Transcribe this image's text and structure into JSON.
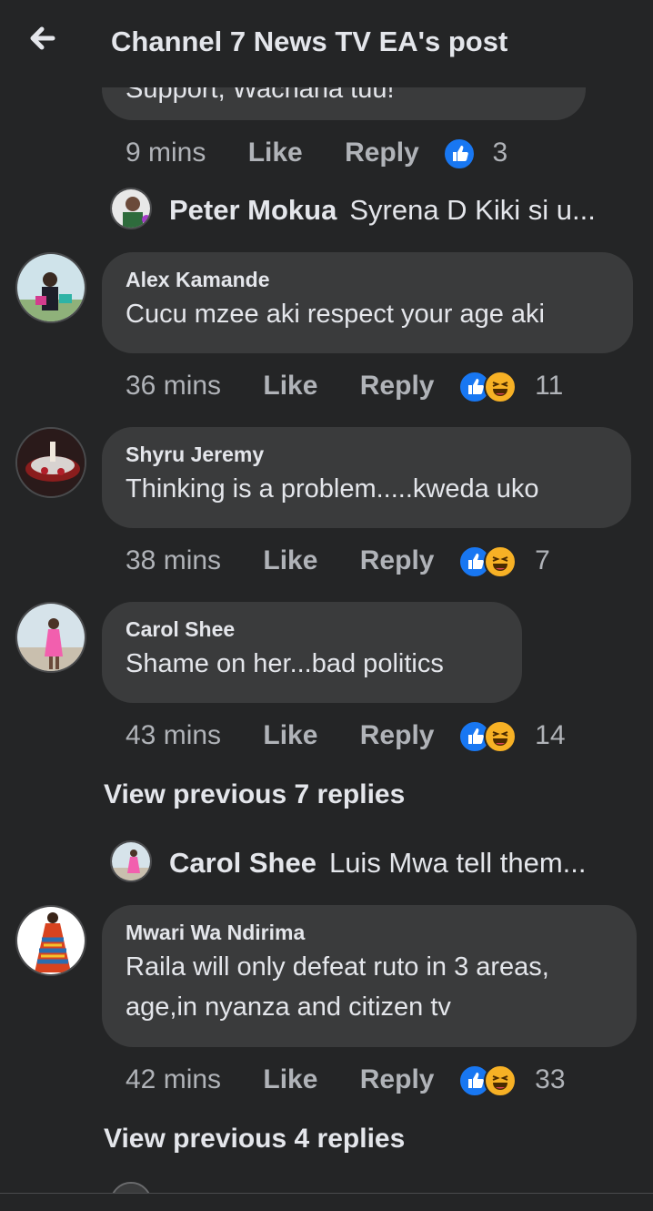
{
  "header": {
    "title": "Channel 7 News TV EA's post"
  },
  "partial_comment": {
    "text": "Support, Wachana tuu!",
    "time": "9 mins",
    "like": "Like",
    "reply": "Reply",
    "reactions": "3"
  },
  "reply_previews": [
    {
      "name": "Peter Mokua",
      "text": "Syrena D Kiki si u..."
    },
    {
      "name": "Carol Shee",
      "text": "Luis Mwa tell them..."
    }
  ],
  "comments": [
    {
      "name": "Alex Kamande",
      "text": "Cucu mzee aki respect your age aki",
      "time": "36 mins",
      "like": "Like",
      "reply": "Reply",
      "reactions": "11"
    },
    {
      "name": "Shyru Jeremy",
      "text": "Thinking is a problem.....kweda uko",
      "time": "38 mins",
      "like": "Like",
      "reply": "Reply",
      "reactions": "7"
    },
    {
      "name": "Carol Shee",
      "text": "Shame on her...bad politics",
      "time": "43 mins",
      "like": "Like",
      "reply": "Reply",
      "reactions": "14"
    },
    {
      "name": "Mwari Wa Ndirima",
      "text_line1": "Raila will only defeat ruto in 3 areas,",
      "text_line2": "age,in nyanza and citizen tv",
      "time": "42 mins",
      "like": "Like",
      "reply": "Reply",
      "reactions": "33"
    }
  ],
  "view_previous": [
    "View previous 7 replies",
    "View previous 4 replies"
  ],
  "colors": {
    "background": "#242526",
    "bubble": "#3a3b3c",
    "like_blue": "#1877f2",
    "haha_yellow": "#f7b125",
    "muted_text": "#b0b3b8"
  }
}
